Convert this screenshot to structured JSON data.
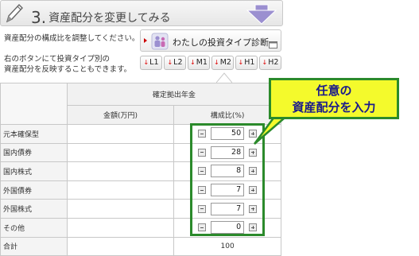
{
  "header": {
    "step_number": "3.",
    "step_title": "資産配分を変更してみる"
  },
  "instructions": {
    "line1": "資産配分の構成比を調整してください。",
    "line2": "右のボタンにて投資タイプ別の",
    "line3": "資産配分を反映することもできます。"
  },
  "diagnosis_button": {
    "label": "わたしの投資タイプ診断"
  },
  "type_buttons": [
    "L1",
    "L2",
    "M1",
    "M2",
    "H1",
    "H2"
  ],
  "table": {
    "group_header": "確定拠出年金",
    "col_amount": "金額(万円)",
    "col_ratio": "構成比(%)",
    "rows": [
      {
        "category": "元本確保型",
        "value": "50"
      },
      {
        "category": "国内債券",
        "value": "28"
      },
      {
        "category": "国内株式",
        "value": "8"
      },
      {
        "category": "外国債券",
        "value": "7"
      },
      {
        "category": "外国株式",
        "value": "7"
      },
      {
        "category": "その他",
        "value": "0"
      }
    ],
    "total_label": "合計",
    "total_value": "100"
  },
  "callout": {
    "line1": "任意の",
    "line2": "資産配分を入力"
  },
  "colors": {
    "highlight_border": "#2b8a2b",
    "callout_bg": "#f4fa2c",
    "callout_text": "#1a1a8c",
    "header_arrow": "#9b8fd0"
  }
}
